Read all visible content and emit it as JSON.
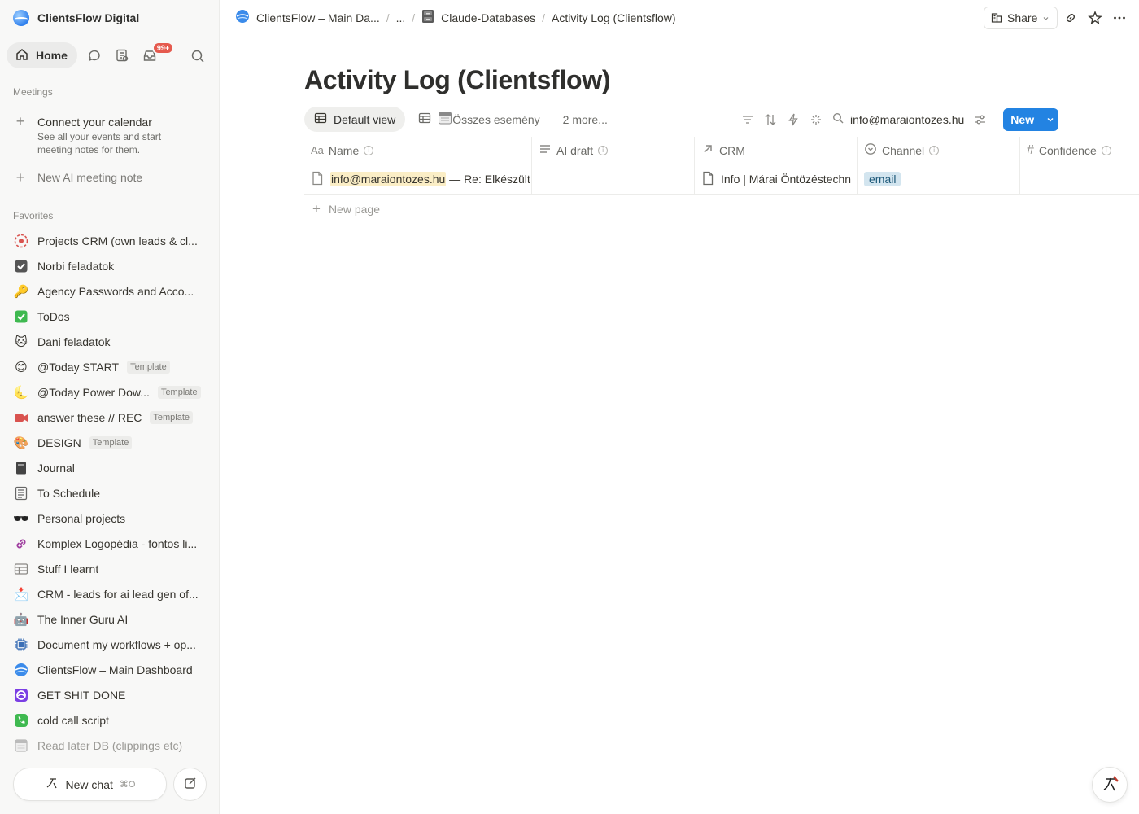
{
  "workspace": {
    "name": "ClientsFlow Digital"
  },
  "nav": {
    "home_label": "Home",
    "inbox_badge": "99+"
  },
  "meetings": {
    "section_label": "Meetings",
    "connect_title": "Connect your calendar",
    "connect_sub": "See all your events and start meeting notes for them.",
    "new_ai_note": "New AI meeting note"
  },
  "favorites": {
    "section_label": "Favorites",
    "items": [
      {
        "label": "Projects CRM (own leads & cl...",
        "icon": "target-icon",
        "template": ""
      },
      {
        "label": "Norbi feladatok",
        "icon": "checkbox-icon",
        "template": ""
      },
      {
        "label": "Agency Passwords and Acco...",
        "icon": "key-icon",
        "template": ""
      },
      {
        "label": "ToDos",
        "icon": "check-mark-icon",
        "template": ""
      },
      {
        "label": "Dani feladatok",
        "icon": "cat-icon",
        "template": ""
      },
      {
        "label": "@Today START",
        "icon": "smile-icon",
        "template": "Template"
      },
      {
        "label": "@Today Power Dow...",
        "icon": "moon-icon",
        "template": "Template"
      },
      {
        "label": "answer these // REC",
        "icon": "video-camera-icon",
        "template": "Template"
      },
      {
        "label": "DESIGN",
        "icon": "palette-icon",
        "template": "Template"
      },
      {
        "label": "Journal",
        "icon": "notebook-icon",
        "template": ""
      },
      {
        "label": "To Schedule",
        "icon": "ledger-icon",
        "template": ""
      },
      {
        "label": "Personal projects",
        "icon": "sunglasses-icon",
        "template": ""
      },
      {
        "label": "Komplex Logopédia - fontos li...",
        "icon": "link-icon",
        "template": ""
      },
      {
        "label": "Stuff I learnt",
        "icon": "table-icon",
        "template": ""
      },
      {
        "label": "CRM - leads for ai lead gen of...",
        "icon": "inbox-tray-icon",
        "template": ""
      },
      {
        "label": "The Inner Guru AI",
        "icon": "robot-icon",
        "template": ""
      },
      {
        "label": "Document my workflows + op...",
        "icon": "chip-icon",
        "template": ""
      },
      {
        "label": "ClientsFlow – Main Dashboard",
        "icon": "globe-icon",
        "template": ""
      },
      {
        "label": "GET SHIT DONE",
        "icon": "purple-circle-icon",
        "template": ""
      },
      {
        "label": "cold call script",
        "icon": "phone-icon",
        "template": ""
      },
      {
        "label": "Read later DB (clippings etc)",
        "icon": "calendar-icon",
        "template": ""
      }
    ]
  },
  "new_chat": {
    "label": "New chat",
    "shortcut": "⌘O"
  },
  "breadcrumb": {
    "root": "ClientsFlow – Main Da...",
    "ellipsis": "...",
    "parent": "Claude-Databases",
    "current": "Activity Log (Clientsflow)"
  },
  "share_label": "Share",
  "page": {
    "title": "Activity Log (Clientsflow)"
  },
  "views": {
    "default": "Default view",
    "second": "Összes esemény",
    "more": "2 more..."
  },
  "search": {
    "value": "info@maraiontozes.hu"
  },
  "new_button": "New",
  "table": {
    "columns": [
      {
        "key": "name",
        "label": "Name",
        "icon": "text-aa-icon"
      },
      {
        "key": "ai_draft",
        "label": "AI draft",
        "icon": "lines-icon"
      },
      {
        "key": "crm",
        "label": "CRM",
        "icon": "arrow-up-right-icon"
      },
      {
        "key": "channel",
        "label": "Channel",
        "icon": "select-icon"
      },
      {
        "key": "confidence",
        "label": "Confidence",
        "icon": "hash-icon"
      }
    ],
    "rows": [
      {
        "name_highlight": "info@maraiontozes.hu",
        "name_rest": " — Re: Elkészült",
        "ai_draft": "",
        "crm": "Info | Márai Öntözéstechn",
        "channel": "email",
        "confidence": ""
      }
    ],
    "new_page": "New page"
  },
  "colors": {
    "accent": "#2383e2",
    "highlight": "#fbeec6",
    "tag_bg": "#d3e5ef"
  }
}
